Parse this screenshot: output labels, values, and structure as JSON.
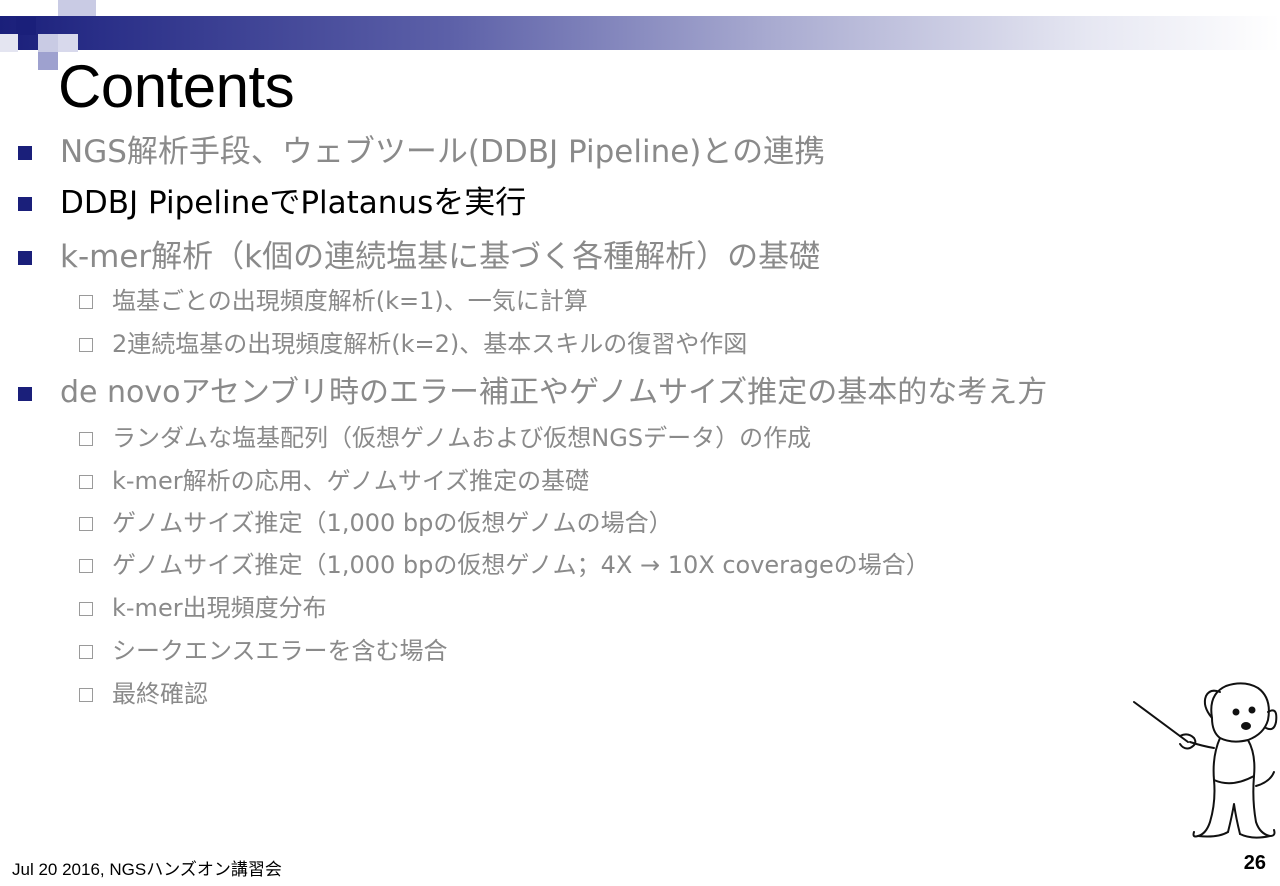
{
  "slide": {
    "title": "Contents",
    "items": [
      {
        "level": 1,
        "text": "NGS解析手段、ウェブツール(DDBJ Pipeline)との連携",
        "state": "dim"
      },
      {
        "level": 1,
        "text": "DDBJ PipelineでPlatanusを実行",
        "state": "active"
      },
      {
        "level": 1,
        "text": "k-mer解析（k個の連続塩基に基づく各種解析）の基礎",
        "state": "dim"
      },
      {
        "level": 2,
        "text": "塩基ごとの出現頻度解析(k=1)、一気に計算",
        "state": "dim"
      },
      {
        "level": 2,
        "text": "2連続塩基の出現頻度解析(k=2)、基本スキルの復習や作図",
        "state": "dim"
      },
      {
        "level": 1,
        "text": "de novoアセンブリ時のエラー補正やゲノムサイズ推定の基本的な考え方",
        "state": "dim"
      },
      {
        "level": 2,
        "text": "ランダムな塩基配列（仮想ゲノムおよび仮想NGSデータ）の作成",
        "state": "dim"
      },
      {
        "level": 2,
        "text": "k-mer解析の応用、ゲノムサイズ推定の基礎",
        "state": "dim"
      },
      {
        "level": 2,
        "text": "ゲノムサイズ推定（1,000 bpの仮想ゲノムの場合）",
        "state": "dim"
      },
      {
        "level": 2,
        "text": "ゲノムサイズ推定（1,000 bpの仮想ゲノム；4X → 10X coverageの場合）",
        "state": "dim"
      },
      {
        "level": 2,
        "text": "k-mer出現頻度分布",
        "state": "dim"
      },
      {
        "level": 2,
        "text": "シークエンスエラーを含む場合",
        "state": "dim"
      },
      {
        "level": 2,
        "text": "最終確認",
        "state": "dim"
      }
    ],
    "footer": "Jul 20 2016, NGSハンズオン講習会",
    "page_number": "26"
  },
  "colors": {
    "accent": "#1a1f7a",
    "dim_text": "#8a8a8a",
    "active_text": "#000000"
  },
  "icons": {
    "level1_marker": "filled-square-bullet-icon",
    "level2_marker": "hollow-square-bullet-icon",
    "mascot": "dog-with-pointer-illustration"
  }
}
